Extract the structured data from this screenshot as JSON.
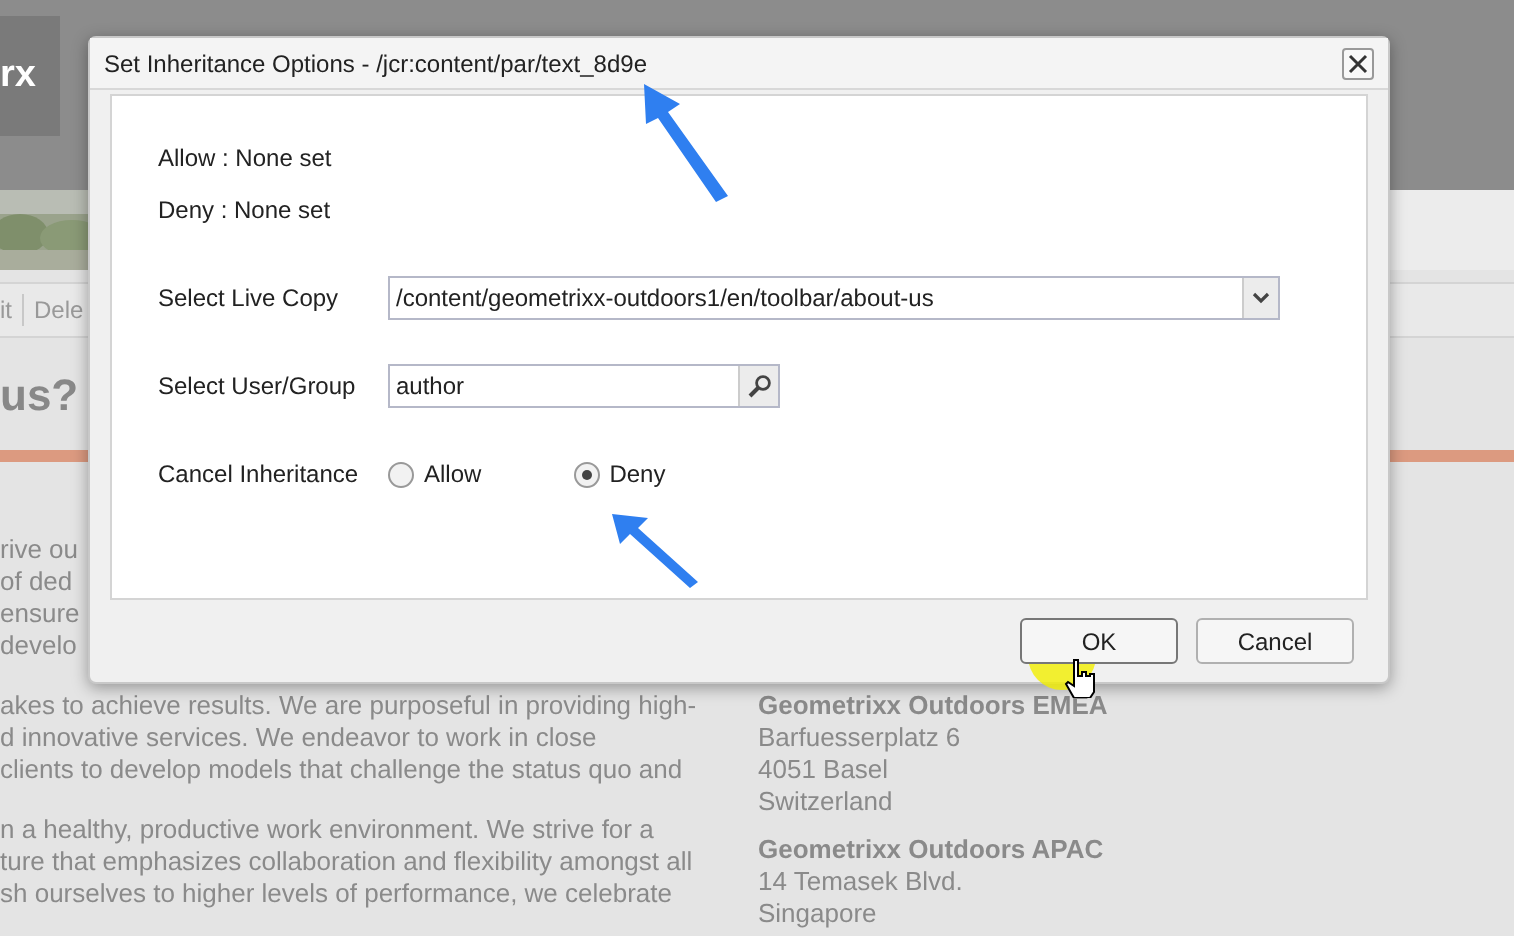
{
  "background_page": {
    "logo_text": "rx",
    "toolbar": [
      "it",
      "Dele"
    ],
    "heading": "us?",
    "paragraphs": [
      [
        "rive ou",
        "of ded",
        "ensure",
        "develo"
      ],
      [
        "akes to achieve results. We are purposeful in providing high-",
        "d innovative services. We endeavor to work in close",
        "clients to develop models that challenge the status quo and"
      ],
      [
        "n a healthy, productive work environment. We strive for a",
        "ture that emphasizes collaboration and flexibility amongst all",
        "sh ourselves to higher levels of performance, we celebrate"
      ]
    ],
    "addresses": [
      {
        "name": "Geometrixx Outdoors EMEA",
        "lines": [
          "Barfuesserplatz 6",
          "4051 Basel",
          "Switzerland"
        ]
      },
      {
        "name": "Geometrixx Outdoors APAC",
        "lines": [
          "14 Temasek Blvd.",
          "Singapore"
        ]
      }
    ]
  },
  "dialog": {
    "title": "Set Inheritance Options - /jcr:content/par/text_8d9e",
    "info": [
      "Allow : None set",
      "Deny : None set"
    ],
    "fields": [
      {
        "kind": "select",
        "label": "Select Live Copy",
        "value": "/content/geometrixx-outdoors1/en/toolbar/about-us"
      },
      {
        "kind": "search",
        "label": "Select User/Group",
        "value": "author"
      },
      {
        "kind": "radio",
        "label": "Cancel Inheritance",
        "options": [
          {
            "label": "Allow",
            "selected": false
          },
          {
            "label": "Deny",
            "selected": true
          }
        ]
      }
    ],
    "buttons": [
      {
        "label": "OK",
        "focused": true
      },
      {
        "label": "Cancel",
        "focused": false
      }
    ]
  }
}
